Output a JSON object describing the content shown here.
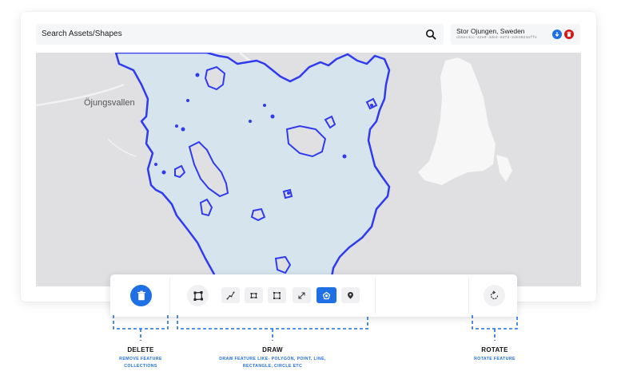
{
  "search": {
    "placeholder": "Search Assets/Shapes",
    "icon": "search-icon"
  },
  "asset": {
    "name": "Stor Ojungen, Sweden",
    "id": "d15ec4cc-42e0-4de4-8d7d-2de3924affe",
    "download_icon": "download-icon",
    "delete_icon": "trash-icon"
  },
  "map": {
    "place_label": "Öjungsvallen"
  },
  "toolbar": {
    "delete_tool": "trash-icon",
    "select_tool": "polygon-select-icon",
    "draw_tools": [
      "line-icon",
      "rectangle-icon",
      "square-icon",
      "resize-icon",
      "polygon-icon",
      "point-icon"
    ],
    "active_draw_tool": "polygon-icon",
    "rotate_tool": "rotate-icon"
  },
  "callouts": {
    "delete": {
      "title": "DELETE",
      "subtitle_1": "REMOVE FEATURE",
      "subtitle_2": "COLLECTIONS"
    },
    "draw": {
      "title": "DRAW",
      "subtitle_1": "DRAW FEATURE LIKE- POLYGON, POINT, LINE,",
      "subtitle_2": "RECTANGLE, CIRCLE ETC"
    },
    "rotate": {
      "title": "ROTATE",
      "subtitle_1": "ROTATE FEATURE"
    }
  },
  "colors": {
    "accent": "#1f6fe5",
    "danger": "#d11a1a",
    "lake_fill": "#d6e4ee",
    "lake_outline": "#2f3bf0",
    "map_bg": "#e0e0e2"
  }
}
